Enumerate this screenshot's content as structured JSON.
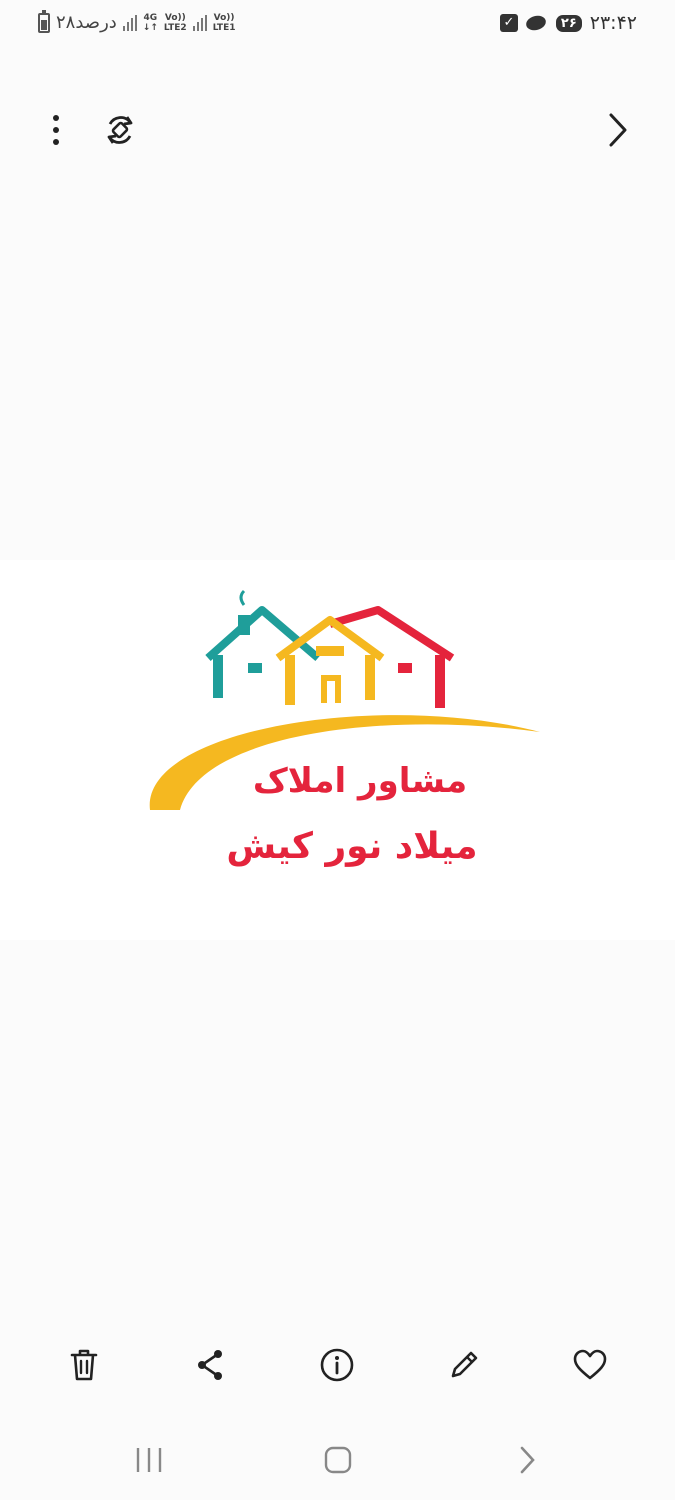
{
  "status_bar": {
    "battery_text": "۲۸درصد",
    "network_1": {
      "top": "4G",
      "bottom": "LTE2",
      "mid": "Vo))"
    },
    "network_2": {
      "top": "Vo))",
      "bottom": "LTE1"
    },
    "notification_badge": "۲۶",
    "clock": "۲۳:۴۲"
  },
  "toolbar": {
    "more_icon": "more-vert-icon",
    "rotate_icon": "rotate-icon",
    "next_icon": "chevron-right-icon"
  },
  "photo": {
    "line1": "مشاور املاک",
    "line2": "میلاد نور کیش",
    "colors": {
      "teal": "#1f9e9a",
      "yellow": "#f5b820",
      "red": "#e4243c"
    }
  },
  "actions": [
    {
      "icon": "delete-icon"
    },
    {
      "icon": "share-icon"
    },
    {
      "icon": "info-icon"
    },
    {
      "icon": "edit-icon"
    },
    {
      "icon": "favorite-icon"
    }
  ],
  "navbar": {
    "recents_icon": "recents-icon",
    "home_icon": "home-icon",
    "back_icon": "back-icon"
  }
}
